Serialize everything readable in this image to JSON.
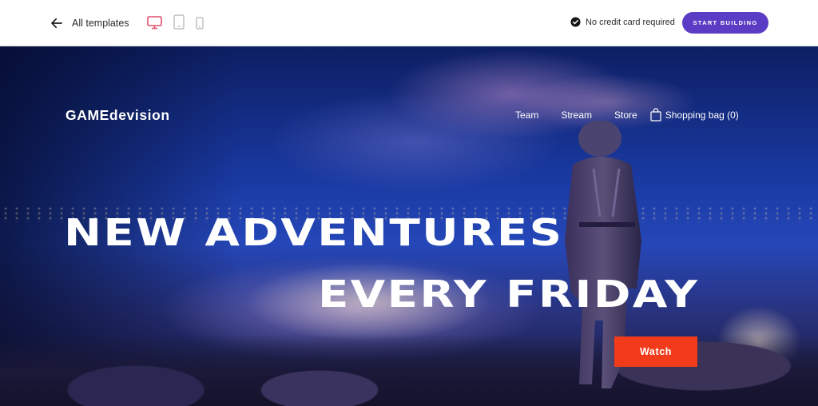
{
  "topbar": {
    "back_label": "All templates",
    "devices": [
      {
        "name": "desktop",
        "active": true
      },
      {
        "name": "tablet",
        "active": false
      },
      {
        "name": "mobile",
        "active": false
      }
    ],
    "no_credit_card_label": "No credit card required",
    "start_building_label": "START BUILDING",
    "colors": {
      "accent": "#5b3cc4",
      "active_device": "#e0506e"
    }
  },
  "site": {
    "logo": "GAMEdevision",
    "nav": {
      "items": [
        "Team",
        "Stream",
        "Store"
      ],
      "shopping_bag_label": "Shopping bag (0)"
    },
    "hero": {
      "headline_line1": "NEW ADVENTURES",
      "headline_line2": "EVERY FRIDAY",
      "cta_label": "Watch",
      "cta_color": "#f23b1b"
    }
  }
}
